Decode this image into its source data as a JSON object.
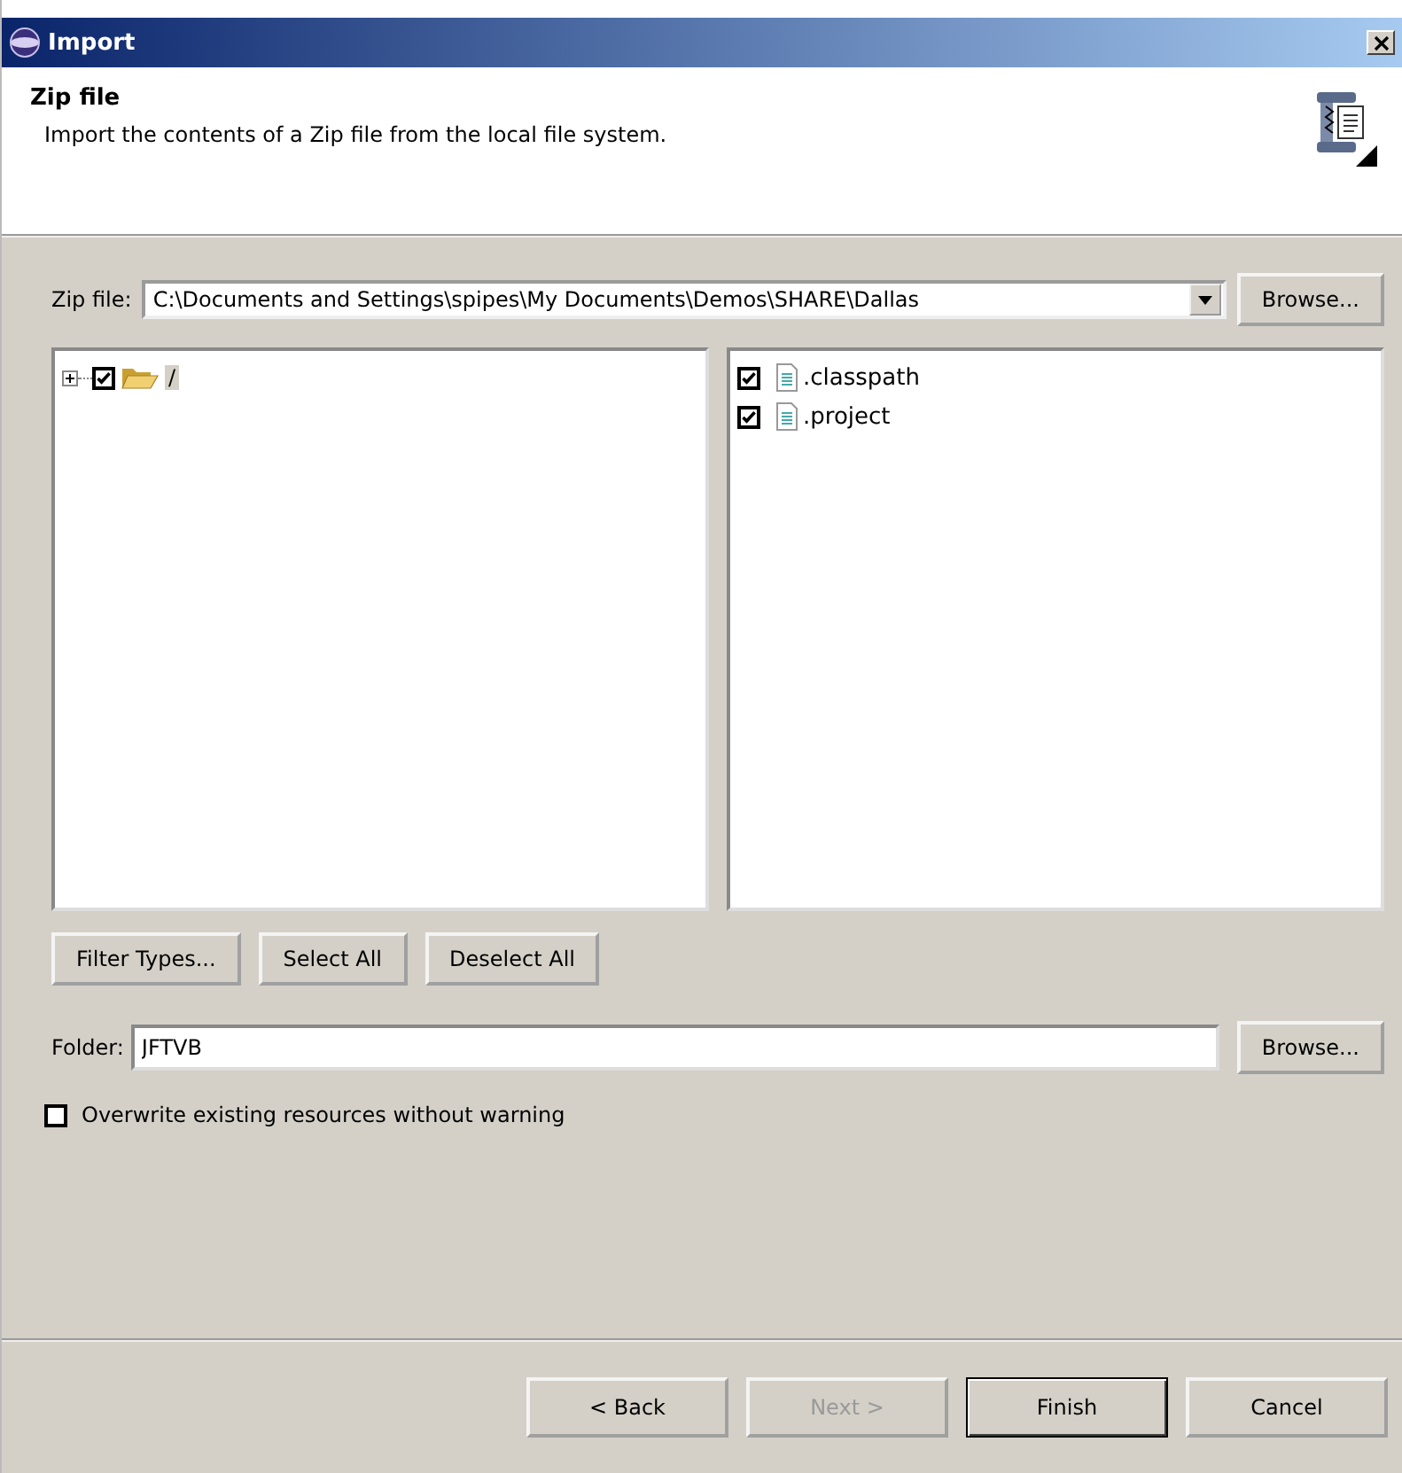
{
  "window": {
    "title": "Import"
  },
  "header": {
    "title": "Zip file",
    "description": "Import the contents of a Zip file from the local file system."
  },
  "zip_file": {
    "label": "Zip file:",
    "value": "C:\\Documents and Settings\\spipes\\My Documents\\Demos\\SHARE\\Dallas",
    "browse": "Browse..."
  },
  "tree": [
    {
      "label": "/",
      "checked": true,
      "expanded": false,
      "selected": true
    }
  ],
  "files": [
    {
      "label": ".classpath",
      "checked": true
    },
    {
      "label": ".project",
      "checked": true
    }
  ],
  "selection_buttons": [
    "Filter Types...",
    "Select All",
    "Deselect All"
  ],
  "folder": {
    "label": "Folder:",
    "value": "JFTVB",
    "browse": "Browse..."
  },
  "overwrite": {
    "label": "Overwrite existing resources without warning",
    "checked": false
  },
  "buttons": [
    {
      "label": "< Back",
      "disabled": false,
      "default": false
    },
    {
      "label": "Next >",
      "disabled": true,
      "default": false
    },
    {
      "label": "Finish",
      "disabled": false,
      "default": true
    },
    {
      "label": "Cancel",
      "disabled": false,
      "default": false
    }
  ]
}
